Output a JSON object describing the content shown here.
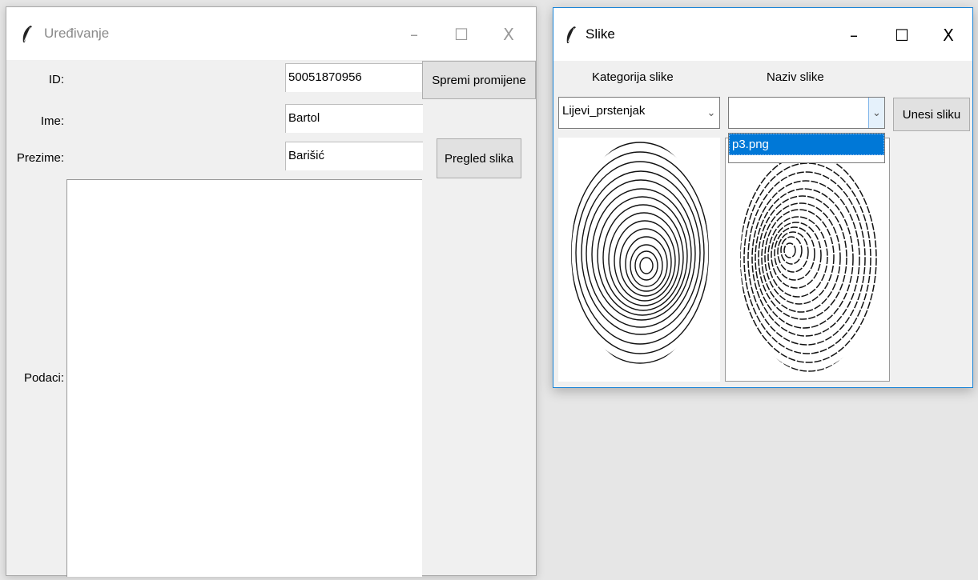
{
  "editor_window": {
    "title": "Uređivanje",
    "controls": {
      "minimize": "–",
      "maximize": "☐",
      "close": "X"
    },
    "fields": {
      "id": {
        "label": "ID:",
        "value": "50051870956"
      },
      "ime": {
        "label": "Ime:",
        "value": "Bartol"
      },
      "prezime": {
        "label": "Prezime:",
        "value": "Barišić"
      },
      "podaci": {
        "label": "Podaci:",
        "value": ""
      }
    },
    "buttons": {
      "save": "Spremi promijene",
      "view_images": "Pregled slika"
    }
  },
  "images_window": {
    "title": "Slike",
    "controls": {
      "minimize": "–",
      "maximize": "☐",
      "close": "X"
    },
    "category_label": "Kategorija slike",
    "name_label": "Naziv slike",
    "category_value": "Lijevi_prstenjak",
    "name_value": "",
    "name_options": [
      "p3.png"
    ],
    "insert_button": "Unesi sliku"
  }
}
